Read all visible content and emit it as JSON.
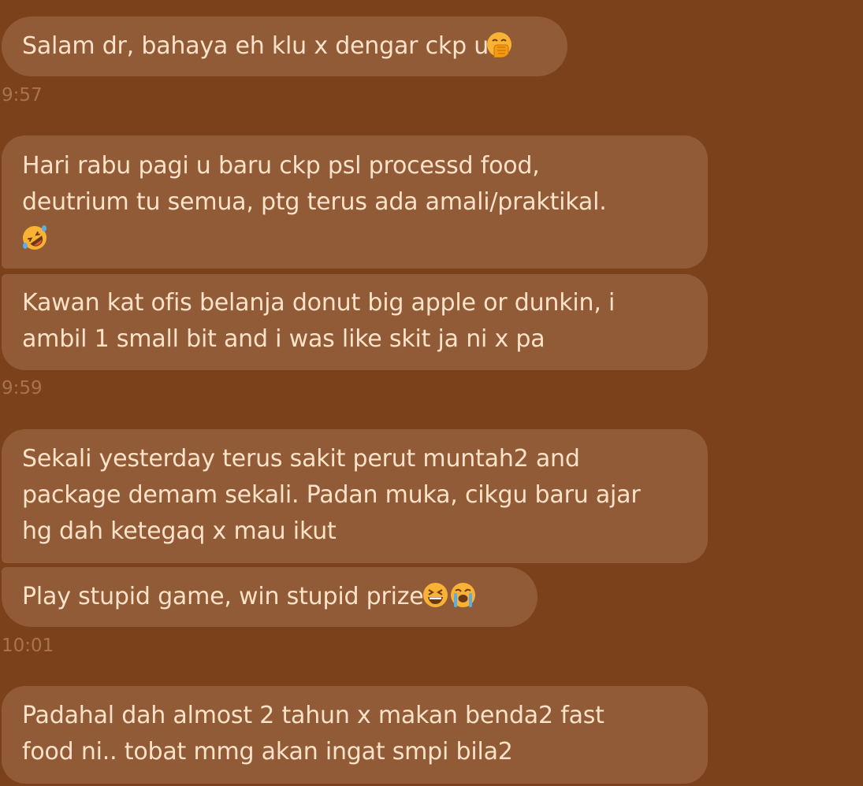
{
  "messages": [
    {
      "lines": [
        "Salam dr, bahaya eh klu x dengar ckp u"
      ],
      "emoji": [
        "hand-over-mouth-emoji"
      ]
    },
    {
      "lines": [
        "Hari rabu pagi u baru ckp psl processd food,",
        "deutrium tu semua, ptg terus ada amali/praktikal."
      ],
      "emoji": [
        "rolling-on-floor-laughing-emoji"
      ]
    },
    {
      "lines": [
        "Kawan kat ofis belanja donut big apple or dunkin, i",
        "ambil 1 small bit and i was like skit ja ni x pa"
      ]
    },
    {
      "lines": [
        "Sekali yesterday terus sakit perut muntah2 and",
        "package demam sekali. Padan muka, cikgu baru ajar",
        "hg dah ketegaq x mau ikut"
      ]
    },
    {
      "lines": [
        "Play stupid game, win stupid prize"
      ],
      "emoji": [
        "grinning-squinting-emoji",
        "loudly-crying-emoji"
      ]
    },
    {
      "lines": [
        "Padahal dah almost 2 tahun x makan benda2 fast",
        "food ni.. tobat mmg akan ingat smpi bila2"
      ]
    }
  ],
  "timestamps": [
    "9:57",
    "9:59",
    "10:01"
  ],
  "colors": {
    "background": "#7B411A",
    "bubble": "#915B37",
    "text": "#FBE2C8",
    "timestamp": "#A6744F"
  }
}
